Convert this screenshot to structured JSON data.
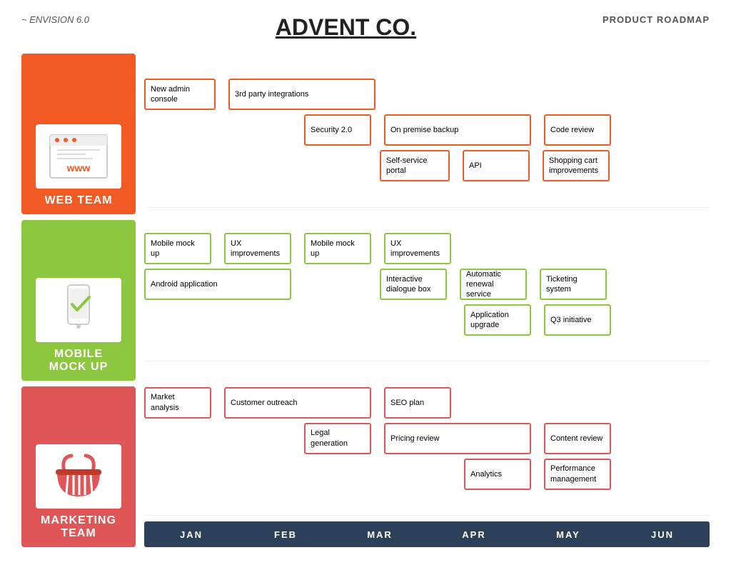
{
  "header": {
    "left": "~ ENVISION 6.0",
    "title": "ADVENT CO.",
    "right": "PRODUCT ROADMAP"
  },
  "teams": [
    {
      "id": "web",
      "label": "WEB TEAM",
      "color": "web"
    },
    {
      "id": "mobile",
      "label": "MOBILE\nMOCK UP",
      "color": "mobile"
    },
    {
      "id": "marketing",
      "label": "MARKETING\nTEAM",
      "color": "marketing"
    }
  ],
  "timeline": {
    "months": [
      "JAN",
      "FEB",
      "MAR",
      "APR",
      "MAY",
      "JUN"
    ]
  },
  "web_tasks": {
    "row1": [
      {
        "label": "New admin console",
        "color": "orange",
        "col": "jan",
        "span": 1
      },
      {
        "label": "3rd party integrations",
        "color": "orange",
        "span": 2
      }
    ],
    "row2": [
      {
        "label": "Security 2.0",
        "color": "orange",
        "col": "mar"
      },
      {
        "label": "On premise backup",
        "color": "orange",
        "span": 2
      },
      {
        "label": "Code review",
        "color": "orange",
        "span": 1
      }
    ],
    "row3": [
      {
        "label": "Self-service portal",
        "color": "orange"
      },
      {
        "label": "API",
        "color": "orange"
      },
      {
        "label": "Shopping cart improvements",
        "color": "orange"
      }
    ]
  },
  "mobile_tasks": {
    "row1": [
      {
        "label": "Mobile mock up",
        "color": "green"
      },
      {
        "label": "UX improvements",
        "color": "green"
      },
      {
        "label": "Mobile mock up",
        "color": "green"
      },
      {
        "label": "UX improvements",
        "color": "green"
      }
    ],
    "row2": [
      {
        "label": "Android application",
        "color": "green",
        "span": 2
      },
      {
        "label": "Interactive dialogue box",
        "color": "green"
      },
      {
        "label": "Automatic renewal service",
        "color": "green"
      },
      {
        "label": "Ticketing system",
        "color": "green"
      }
    ],
    "row3": [
      {
        "label": "Application upgrade",
        "color": "green"
      },
      {
        "label": "Q3 initiative",
        "color": "green"
      }
    ]
  },
  "marketing_tasks": {
    "row1": [
      {
        "label": "Market analysis",
        "color": "red"
      },
      {
        "label": "Customer outreach",
        "color": "red",
        "span": 2
      },
      {
        "label": "SEO plan",
        "color": "red"
      }
    ],
    "row2": [
      {
        "label": "Legal generation",
        "color": "red"
      },
      {
        "label": "Pricing review",
        "color": "red",
        "span": 2
      },
      {
        "label": "Content review",
        "color": "red"
      }
    ],
    "row3": [
      {
        "label": "Analytics",
        "color": "red"
      },
      {
        "label": "Performance management",
        "color": "red"
      }
    ]
  }
}
